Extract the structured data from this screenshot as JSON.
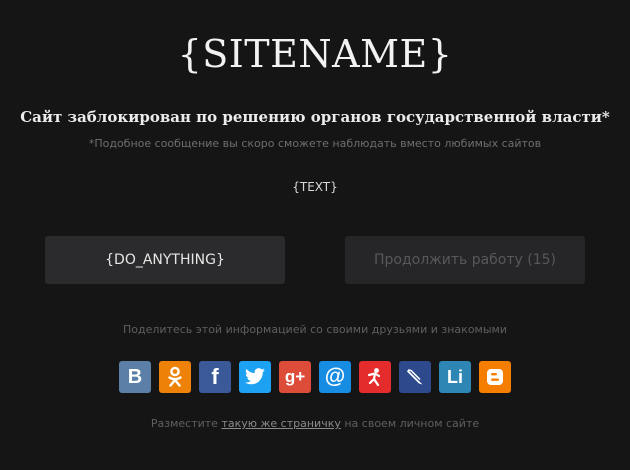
{
  "site_title": "{SITENAME}",
  "headline": "Сайт заблокирован по решению органов государственной власти*",
  "footnote": "*Подобное сообщение вы скоро сможете наблюдать вместо любимых сайтов",
  "text_placeholder": "{TEXT}",
  "buttons": {
    "primary_label": "{DO_ANYTHING}",
    "continue_label": "Продолжить работу (15)"
  },
  "share_text": "Поделитесь этой информацией со своими друзьями и знакомыми",
  "social": [
    {
      "name": "vkontakte",
      "glyph": "В",
      "color": "#5b7fa6",
      "icon": "vk-icon"
    },
    {
      "name": "odnoklassniki",
      "glyph": "",
      "color": "#ee8208",
      "icon": "odnoklassniki-icon"
    },
    {
      "name": "facebook",
      "glyph": "f",
      "color": "#3b5998",
      "icon": "facebook-icon"
    },
    {
      "name": "twitter",
      "glyph": "",
      "color": "#1da1f2",
      "icon": "twitter-icon"
    },
    {
      "name": "google-plus",
      "glyph": "g+",
      "color": "#dd4b39",
      "icon": "google-plus-icon"
    },
    {
      "name": "mail-ru",
      "glyph": "@",
      "color": "#168de2",
      "icon": "mail-ru-icon"
    },
    {
      "name": "moi-krug",
      "glyph": "",
      "color": "#e52c2c",
      "icon": "moi-krug-icon"
    },
    {
      "name": "livejournal",
      "glyph": "",
      "color": "#2e4a8c",
      "icon": "livejournal-icon"
    },
    {
      "name": "liveinternet",
      "glyph": "Li",
      "color": "#2e86b5",
      "icon": "liveinternet-icon"
    },
    {
      "name": "blogger",
      "glyph": "",
      "color": "#f57d00",
      "icon": "blogger-icon"
    }
  ],
  "footer": {
    "before": "Разместите ",
    "link": "такую же страничку",
    "after": " на своем личном сайте"
  }
}
